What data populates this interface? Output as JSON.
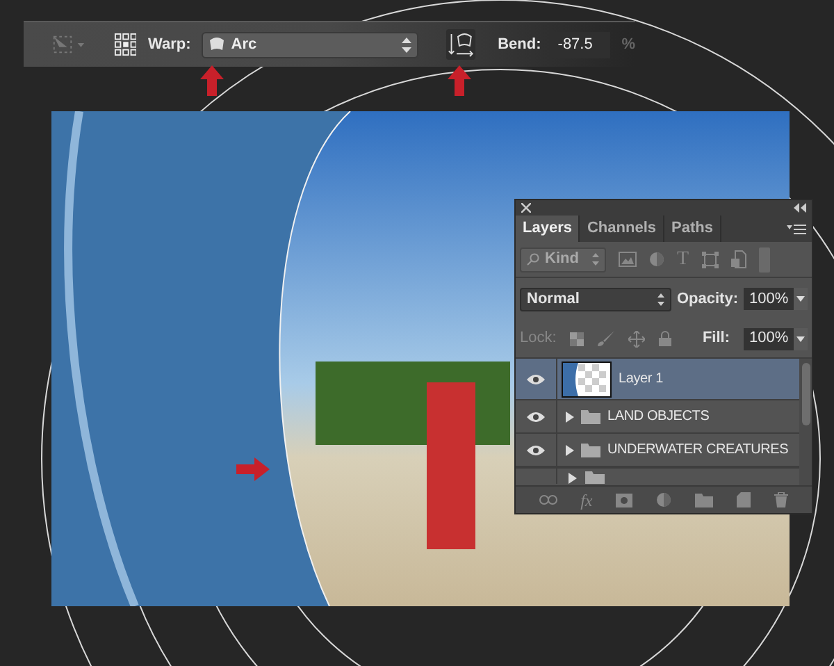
{
  "toolbar": {
    "warp_label": "Warp:",
    "warp_style": "Arc",
    "bend_label": "Bend:",
    "bend_value": "-87.5",
    "bend_unit": "%"
  },
  "layers_panel": {
    "tabs": [
      {
        "label": "Layers",
        "selected": true
      },
      {
        "label": "Channels",
        "selected": false
      },
      {
        "label": "Paths",
        "selected": false
      }
    ],
    "filter_kind": "Kind",
    "type_filter_glyph": "T",
    "fx_glyph": "fx",
    "blend_mode": "Normal",
    "opacity_label": "Opacity:",
    "opacity_value": "100%",
    "lock_label": "Lock:",
    "fill_label": "Fill:",
    "fill_value": "100%",
    "layers": [
      {
        "name": "Layer 1",
        "kind": "pixel",
        "selected": true,
        "visible": true
      },
      {
        "name": "LAND OBJECTS",
        "kind": "group",
        "selected": false,
        "visible": true
      },
      {
        "name": "UNDERWATER CREATURES",
        "kind": "group",
        "selected": false,
        "visible": true
      }
    ]
  }
}
